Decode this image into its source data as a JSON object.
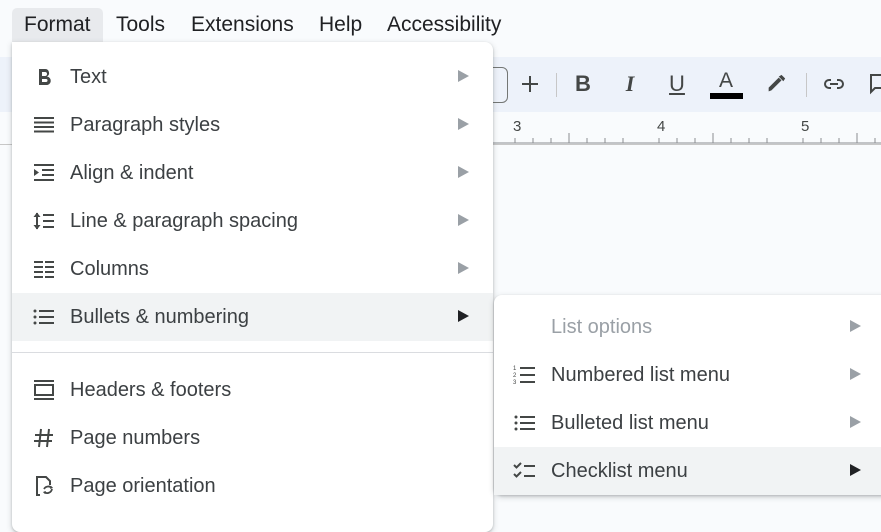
{
  "menubar": {
    "items": [
      {
        "label": "Format",
        "active": true
      },
      {
        "label": "Tools"
      },
      {
        "label": "Extensions"
      },
      {
        "label": "Help"
      },
      {
        "label": "Accessibility"
      }
    ]
  },
  "toolbar": {
    "buttons": [
      {
        "name": "increase-font-size",
        "glyph": "+"
      },
      {
        "name": "bold",
        "glyph": "B"
      },
      {
        "name": "italic",
        "glyph": "I"
      },
      {
        "name": "underline",
        "glyph": "U"
      },
      {
        "name": "text-color",
        "glyph": "A",
        "color": "#000000"
      },
      {
        "name": "highlight",
        "glyph": "✎"
      },
      {
        "name": "insert-link",
        "glyph": "🔗"
      },
      {
        "name": "add-comment",
        "glyph": "💬"
      }
    ]
  },
  "ruler": {
    "numbers": [
      "3",
      "4",
      "5"
    ]
  },
  "format_menu": {
    "items": [
      {
        "label": "Text",
        "icon": "bold-icon",
        "submenu": true
      },
      {
        "label": "Paragraph styles",
        "icon": "paragraph-styles-icon",
        "submenu": true
      },
      {
        "label": "Align & indent",
        "icon": "indent-icon",
        "submenu": true
      },
      {
        "label": "Line & paragraph spacing",
        "icon": "line-spacing-icon",
        "submenu": true
      },
      {
        "label": "Columns",
        "icon": "columns-icon",
        "submenu": true
      },
      {
        "label": "Bullets & numbering",
        "icon": "bulleted-list-icon",
        "submenu": true,
        "highlighted": true
      },
      {
        "label": "Headers & footers",
        "icon": "headers-footers-icon",
        "submenu": false
      },
      {
        "label": "Page numbers",
        "icon": "hash-icon",
        "submenu": false
      },
      {
        "label": "Page orientation",
        "icon": "page-orientation-icon",
        "submenu": false
      }
    ]
  },
  "bullets_submenu": {
    "items": [
      {
        "label": "List options",
        "disabled": true,
        "submenu": true
      },
      {
        "label": "Numbered list menu",
        "icon": "numbered-list-icon",
        "submenu": true
      },
      {
        "label": "Bulleted list menu",
        "icon": "bulleted-list-icon",
        "submenu": true
      },
      {
        "label": "Checklist menu",
        "icon": "checklist-icon",
        "submenu": true,
        "highlighted": true
      }
    ]
  }
}
